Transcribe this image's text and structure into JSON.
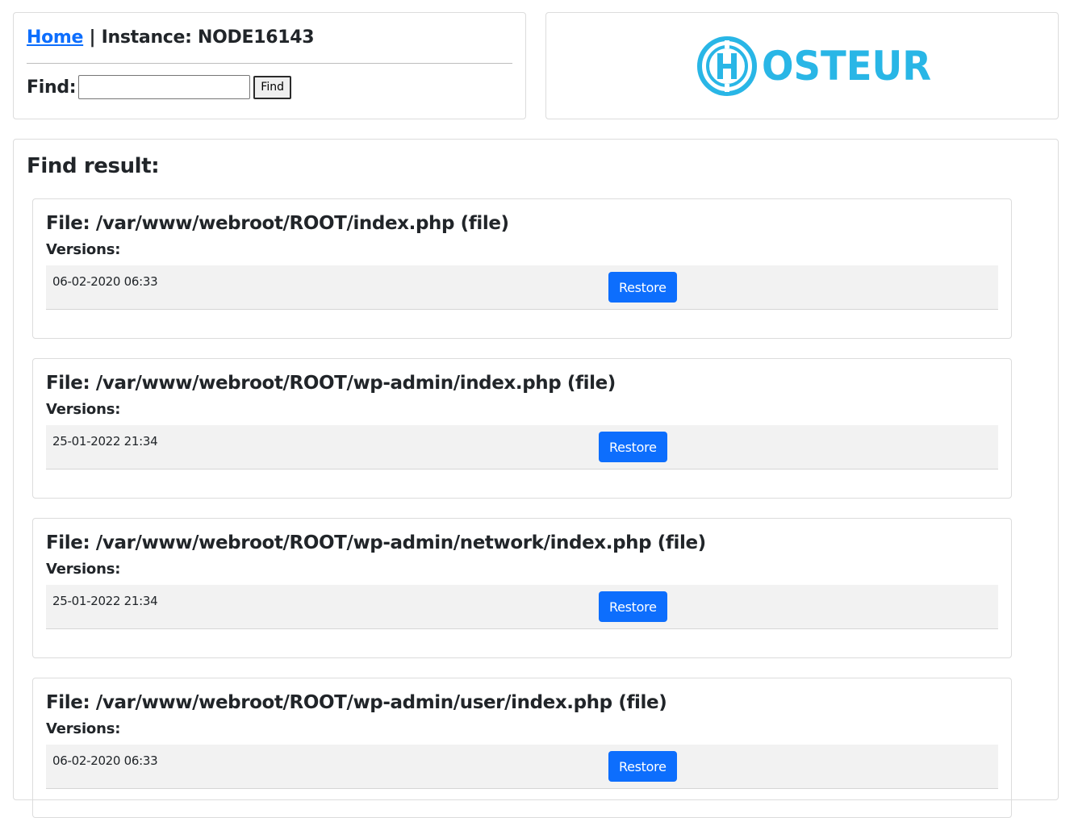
{
  "header": {
    "home_link": "Home",
    "separator": "|",
    "instance_label": "Instance:",
    "instance_id": "NODE16143"
  },
  "search": {
    "label": "Find:",
    "value": "",
    "button_label": "Find"
  },
  "logo": {
    "text": "OSTEUR",
    "monogram": "H",
    "color": "#29b6e6"
  },
  "results": {
    "title": "Find result:",
    "files": [
      {
        "title_prefix": "File:",
        "path": "/var/www/webroot/ROOT/index.php",
        "type": "(file)",
        "versions_label": "Versions:",
        "versions": [
          {
            "date": "06-02-2020 06:33",
            "button": "Restore"
          }
        ]
      },
      {
        "title_prefix": "File:",
        "path": "/var/www/webroot/ROOT/wp-admin/index.php",
        "type": "(file)",
        "versions_label": "Versions:",
        "versions": [
          {
            "date": "25-01-2022 21:34",
            "button": "Restore"
          }
        ]
      },
      {
        "title_prefix": "File:",
        "path": "/var/www/webroot/ROOT/wp-admin/network/index.php",
        "type": "(file)",
        "versions_label": "Versions:",
        "versions": [
          {
            "date": "25-01-2022 21:34",
            "button": "Restore"
          }
        ]
      },
      {
        "title_prefix": "File:",
        "path": "/var/www/webroot/ROOT/wp-admin/user/index.php",
        "type": "(file)",
        "versions_label": "Versions:",
        "versions": [
          {
            "date": "06-02-2020 06:33",
            "button": "Restore"
          }
        ]
      }
    ]
  },
  "colors": {
    "link": "#0d6efd",
    "primary_button": "#0d6efd",
    "row_background": "#f2f2f2"
  }
}
